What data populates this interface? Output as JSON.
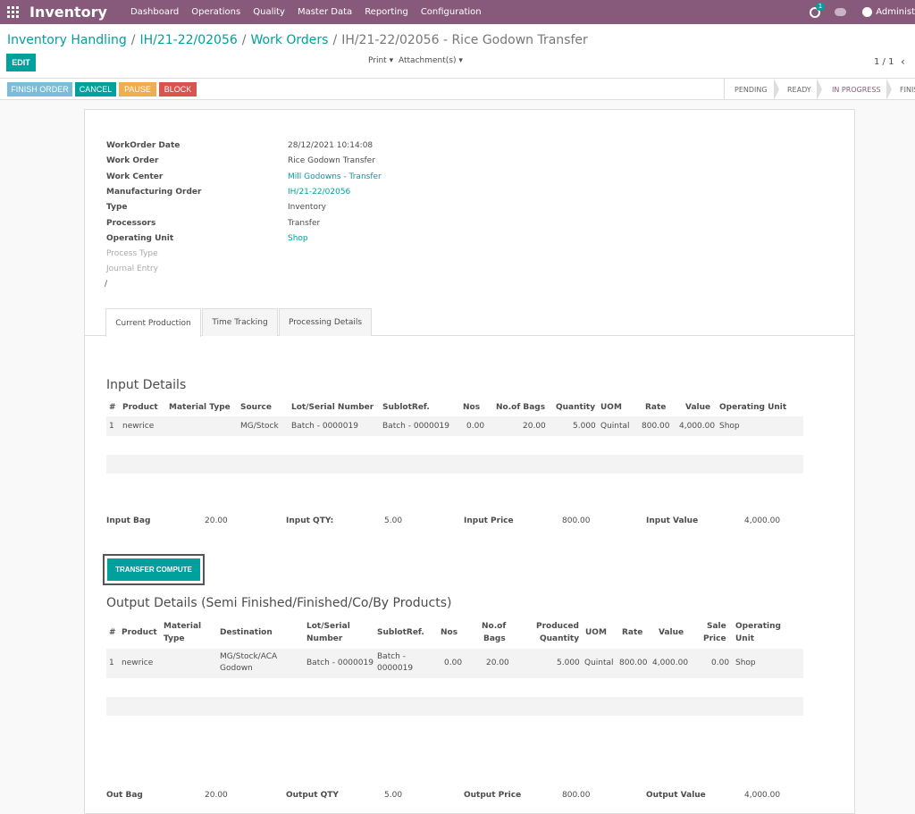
{
  "app": {
    "title": "Inventory",
    "menu": [
      "Dashboard",
      "Operations",
      "Quality",
      "Master Data",
      "Reporting",
      "Configuration"
    ],
    "activity_count": "1",
    "user": "Administ"
  },
  "breadcrumb": {
    "items": [
      "Inventory Handling",
      "IH/21-22/02056",
      "Work Orders"
    ],
    "current": "IH/21-22/02056 - Rice Godown Transfer"
  },
  "toolbar": {
    "edit": "EDIT",
    "print": "Print ▾",
    "attachments": "Attachment(s) ▾",
    "pager": "1 / 1",
    "prev": "‹"
  },
  "status_buttons": {
    "finish": "FINISH ORDER",
    "cancel": "CANCEL",
    "pause": "PAUSE",
    "block": "BLOCK"
  },
  "stages": [
    "PENDING",
    "READY",
    "IN PROGRESS",
    "FINIS"
  ],
  "colors": {
    "brand": "#875a7b",
    "primary": "#00a09d",
    "finish": "#7bbcd8",
    "pause": "#f0ad4e",
    "block": "#d9534f"
  },
  "fields": {
    "workorder_date": {
      "label": "WorkOrder Date",
      "value": "28/12/2021 10:14:08"
    },
    "work_order": {
      "label": "Work Order",
      "value": "Rice Godown Transfer"
    },
    "work_center": {
      "label": "Work Center",
      "value": "Mill Godowns - Transfer"
    },
    "manufacturing_order": {
      "label": "Manufacturing Order",
      "value": "IH/21-22/02056"
    },
    "type": {
      "label": "Type",
      "value": "Inventory"
    },
    "processors": {
      "label": "Processors",
      "value": "Transfer"
    },
    "operating_unit": {
      "label": "Operating Unit",
      "value": "Shop"
    },
    "process_type": {
      "label": "Process Type"
    },
    "journal_entry": {
      "label": "Journal Entry"
    },
    "slash": "/"
  },
  "tabs": [
    "Current Production",
    "Time Tracking",
    "Processing Details"
  ],
  "input": {
    "title": "Input Details",
    "headers": [
      "#",
      "Product",
      "Material Type",
      "Source",
      "Lot/Serial Number",
      "SublotRef.",
      "Nos",
      "No.of Bags",
      "Quantity",
      "UOM",
      "Rate",
      "Value",
      "Operating Unit"
    ],
    "row": [
      "1",
      "newrice",
      "",
      "MG/Stock",
      "Batch - 0000019",
      "Batch - 0000019",
      "0.00",
      "20.00",
      "5.000",
      "Quintal",
      "800.00",
      "4,000.00",
      "Shop"
    ],
    "summary": {
      "bag_label": "Input Bag",
      "bag": "20.00",
      "qty_label": "Input QTY:",
      "qty": "5.00",
      "price_label": "Input Price",
      "price": "800.00",
      "value_label": "Input Value",
      "value": "4,000.00"
    }
  },
  "compute_button": "TRANSFER COMPUTE",
  "output": {
    "title": "Output Details (Semi Finished/Finished/Co/By Products)",
    "headers": {
      "num": "#",
      "product": "Product",
      "material_1": "Material",
      "material_2": "Type",
      "destination": "Destination",
      "lot_1": "Lot/Serial",
      "lot_2": "Number",
      "sublot": "SublotRef.",
      "nos": "Nos",
      "bags_1": "No.of",
      "bags_2": "Bags",
      "produced_1": "Produced",
      "produced_2": "Quantity",
      "uom": "UOM",
      "rate": "Rate",
      "value": "Value",
      "sale_1": "Sale",
      "sale_2": "Price",
      "ou_1": "Operating",
      "ou_2": "Unit"
    },
    "row": {
      "num": "1",
      "product": "newrice",
      "destination_1": "MG/Stock/ACA",
      "destination_2": "Godown",
      "lot": "Batch - 0000019",
      "sublot_1": "Batch -",
      "sublot_2": "0000019",
      "nos": "0.00",
      "bags": "20.00",
      "produced": "5.000",
      "uom": "Quintal",
      "rate": "800.00",
      "value": "4,000.00",
      "sale_price": "0.00",
      "operating_unit": "Shop"
    },
    "summary": {
      "bag_label": "Out Bag",
      "bag": "20.00",
      "qty_label": "Output QTY",
      "qty": "5.00",
      "price_label": "Output Price",
      "price": "800.00",
      "value_label": "Output Value",
      "value": "4,000.00"
    }
  }
}
